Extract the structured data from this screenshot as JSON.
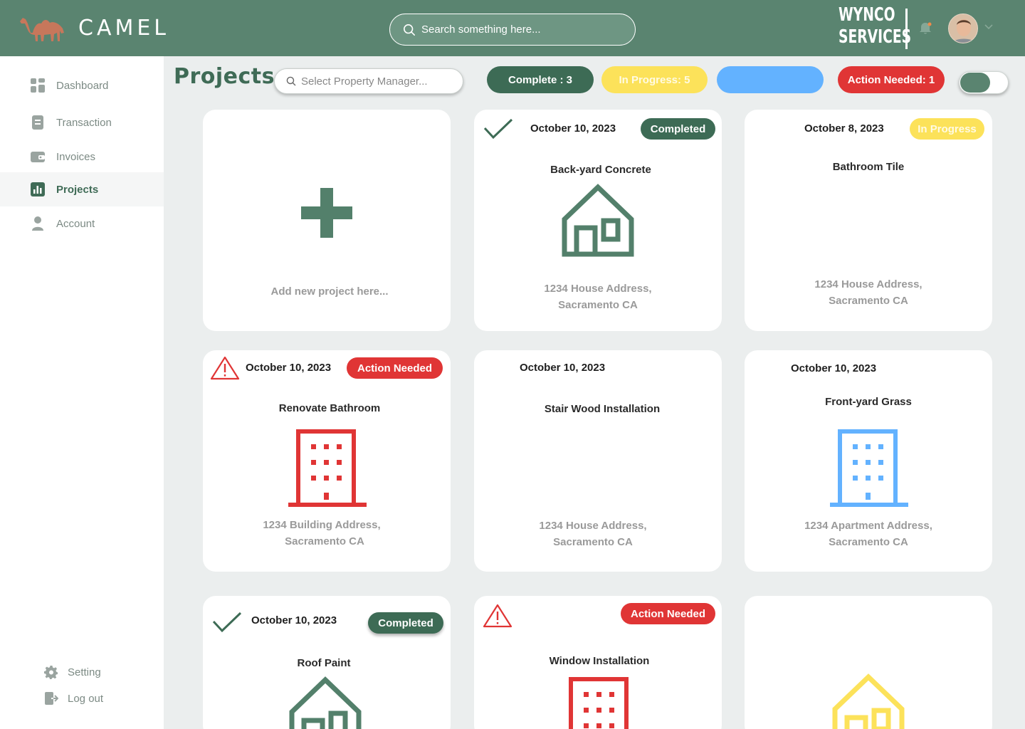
{
  "header": {
    "brand": "CAMEL",
    "search_placeholder": "Search something here...",
    "company_line1": "WYNCO",
    "company_line2": "SERVICES"
  },
  "sidebar": {
    "items": [
      {
        "label": "Dashboard",
        "icon": "dashboard-icon"
      },
      {
        "label": "Transaction",
        "icon": "document-icon"
      },
      {
        "label": "Invoices",
        "icon": "wallet-icon"
      },
      {
        "label": "Projects",
        "icon": "chart-icon",
        "active": true
      },
      {
        "label": "Account",
        "icon": "user-icon"
      }
    ],
    "footer": [
      {
        "label": "Setting",
        "icon": "gear-icon"
      },
      {
        "label": "Log out",
        "icon": "logout-icon"
      }
    ]
  },
  "toolbar": {
    "title": "Projects",
    "pm_placeholder": "Select Property Manager...",
    "pills": {
      "complete": "Complete : 3",
      "in_progress": "In Progress: 5",
      "blue": "",
      "action": "Action Needed: 1"
    }
  },
  "cards": {
    "add": {
      "label": "Add new project here..."
    },
    "c1": {
      "date": "October 10, 2023",
      "status": "Completed",
      "title": "Back-yard Concrete",
      "address_line1": "1234 House Address,",
      "address_line2": "Sacramento CA"
    },
    "c2": {
      "date": "October 8, 2023",
      "status": "In Progress",
      "title": "Bathroom Tile",
      "address_line1": "1234 House Address,",
      "address_line2": "Sacramento CA"
    },
    "c3": {
      "date": "October 10, 2023",
      "status": "Action Needed",
      "title": "Renovate Bathroom",
      "address_line1": "1234 Building Address,",
      "address_line2": "Sacramento CA"
    },
    "c4": {
      "date": "October 10, 2023",
      "title": "Stair Wood Installation",
      "address_line1": "1234 House Address,",
      "address_line2": "Sacramento CA"
    },
    "c5": {
      "date": "October 10, 2023",
      "title": "Front-yard Grass",
      "address_line1": "1234  Apartment Address,",
      "address_line2": "Sacramento CA"
    },
    "c6": {
      "date": "October 10, 2023",
      "status": "Completed",
      "title": "Roof Paint"
    },
    "c7": {
      "status": "Action Needed",
      "title": "Window Installation"
    }
  },
  "colors": {
    "header": "#5A8470",
    "primary_green": "#3D6B55",
    "icon_green": "#53806B",
    "yellow": "#FCE25A",
    "blue": "#63B2FF",
    "red": "#E03535"
  }
}
